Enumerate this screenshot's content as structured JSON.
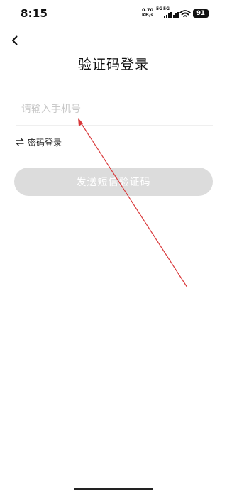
{
  "status_bar": {
    "time": "8:15",
    "net_speed_value": "0.70",
    "net_speed_unit": "KB/s",
    "signal1_label": "5G",
    "signal2_label": "5G",
    "battery": "91"
  },
  "header": {
    "title": "验证码登录"
  },
  "phone_input": {
    "value": "",
    "placeholder": "请输入手机号"
  },
  "switch_login": {
    "label": "密码登录"
  },
  "send_code_button": {
    "label": "发送短信验证码"
  },
  "icons": {
    "back": "chevron-left-icon",
    "switch": "swap-arrows-icon",
    "wifi": "wifi-icon",
    "signal": "signal-bars-icon"
  },
  "colors": {
    "button_disabled_bg": "#dcdcdc",
    "placeholder": "#c8c8c8",
    "annotation_arrow": "#d9383a"
  }
}
